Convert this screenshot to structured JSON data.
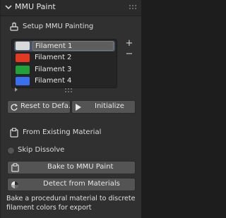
{
  "header": {
    "title": "MMU Paint",
    "collapse_icon": "chevron-down-icon",
    "drag_icon": "grip-icon"
  },
  "setup": {
    "label": "Setup MMU Painting",
    "icon": "brush-icon"
  },
  "filaments": [
    {
      "name": "Filament 1",
      "color": "#d9d9d9",
      "active": true
    },
    {
      "name": "Filament 2",
      "color": "#e23a22",
      "active": false
    },
    {
      "name": "Filament 3",
      "color": "#1fa338",
      "active": false
    },
    {
      "name": "Filament 4",
      "color": "#3a6ff0",
      "active": false
    }
  ],
  "list_controls": {
    "add": "+",
    "remove": "−"
  },
  "actions": {
    "reset_label": "Reset to Defa...",
    "reset_icon": "refresh-icon",
    "initialize_label": "Initialize",
    "initialize_icon": "play-icon"
  },
  "from_material": {
    "label": "From Existing Material",
    "icon": "paste-icon",
    "skip_dissolve_label": "Skip Dissolve",
    "skip_dissolve_checked": false,
    "bake_label": "Bake to MMU Paint",
    "bake_icon": "paste-icon",
    "detect_label": "Detect from Materials",
    "detect_icon": "material-sphere-icon"
  },
  "description": "Bake a procedural material to discrete filament colors for export",
  "colors": {
    "panel_bg": "#303030",
    "active_row": "#4b5569",
    "button_bg": "#545454"
  }
}
